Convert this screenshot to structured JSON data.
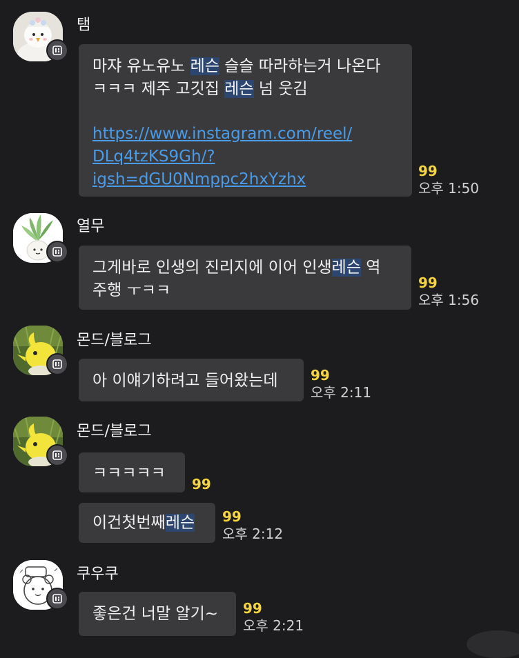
{
  "colors": {
    "background": "#1c1c1e",
    "bubble": "#3a3a3c",
    "unread": "#f5d442",
    "link": "#4a9be8",
    "search_highlight": "#2c4670"
  },
  "messages": [
    {
      "sender": "탬",
      "avatar_icon": "snowman-doll-avatar",
      "bubbles": [
        {
          "lines": [
            {
              "pre": "마쟈 유노유노 ",
              "hl": "레슨",
              "post": " 슬슬 따라하는거 나온다"
            },
            {
              "pre": "ㅋㅋㅋ 제주 고깃집 ",
              "hl": "레슨",
              "post": " 넘 웃김"
            }
          ],
          "link_lines": [
            "https://www.instagram.com/reel/",
            "DLq4tzKS9Gh/?",
            "igsh=dGU0Nmppc2hxYzhx"
          ],
          "unread": "99",
          "time": "오후 1:50"
        }
      ]
    },
    {
      "sender": "열무",
      "avatar_icon": "radish-character-avatar",
      "bubbles": [
        {
          "lines": [
            {
              "pre": "그게바로 인생의 진리지에 이어 인생",
              "hl": "레슨",
              "post": " 역"
            },
            {
              "pre": "주행 ㅜㅋㅋ",
              "hl": "",
              "post": ""
            }
          ],
          "unread": "99",
          "time": "오후 1:56"
        }
      ]
    },
    {
      "sender": "몬드/블로그",
      "avatar_icon": "yellow-bird-character-avatar",
      "bubbles": [
        {
          "lines": [
            {
              "pre": "아 이얘기하려고 들어왔는데",
              "hl": "",
              "post": ""
            }
          ],
          "unread": "99",
          "time": "오후 2:11"
        }
      ]
    },
    {
      "sender": "몬드/블로그",
      "avatar_icon": "yellow-bird-character-avatar",
      "bubbles": [
        {
          "lines": [
            {
              "pre": "ㅋㅋㅋㅋㅋ",
              "hl": "",
              "post": ""
            }
          ],
          "unread": "99",
          "time": ""
        },
        {
          "lines": [
            {
              "pre": "이건첫번째",
              "hl": "레슨",
              "post": ""
            }
          ],
          "unread": "99",
          "time": "오후 2:12"
        }
      ]
    },
    {
      "sender": "쿠우쿠",
      "avatar_icon": "bear-sketch-avatar",
      "bubbles": [
        {
          "lines": [
            {
              "pre": "좋은건 너말 알기~",
              "hl": "",
              "post": ""
            }
          ],
          "unread": "99",
          "time": "오후 2:21"
        }
      ]
    }
  ]
}
